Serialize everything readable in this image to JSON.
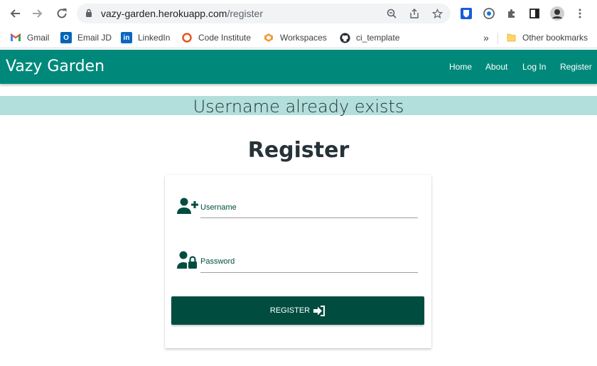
{
  "browser": {
    "url_host": "vazy-garden.herokuapp.com",
    "url_path": "/register",
    "bookmarks": [
      {
        "label": "Gmail",
        "icon": "gmail-icon"
      },
      {
        "label": "Email JD",
        "icon": "outlook-icon"
      },
      {
        "label": "LinkedIn",
        "icon": "linkedin-icon"
      },
      {
        "label": "Code Institute",
        "icon": "code-institute-icon"
      },
      {
        "label": "Workspaces",
        "icon": "workspaces-icon"
      },
      {
        "label": "ci_template",
        "icon": "github-icon"
      }
    ],
    "overflow": "»",
    "other_bookmarks": "Other bookmarks"
  },
  "navbar": {
    "brand": "Vazy Garden",
    "links": [
      "Home",
      "About",
      "Log In",
      "Register"
    ],
    "color": "#00897b"
  },
  "flash": {
    "message": "Username already exists",
    "color": "#b2dfdb"
  },
  "page": {
    "title": "Register"
  },
  "form": {
    "username_label": "Username",
    "password_label": "Password",
    "submit_label": "REGISTER",
    "accent": "#004d40"
  }
}
